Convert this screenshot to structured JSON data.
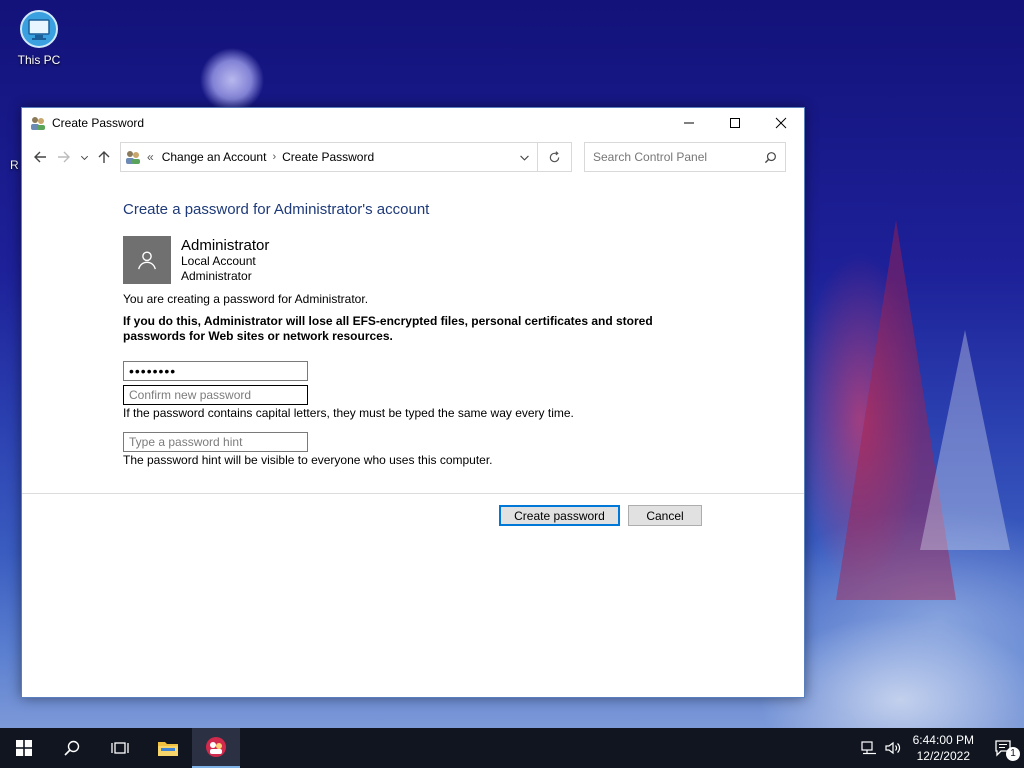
{
  "desktop": {
    "icon_label": "This PC",
    "edge_label": "R"
  },
  "window": {
    "title": "Create Password",
    "address": {
      "overflow": "«",
      "crumbs": [
        "Change an Account",
        "Create Password"
      ],
      "separator": "›"
    },
    "search_placeholder": "Search Control Panel"
  },
  "content": {
    "heading": "Create a password for Administrator's account",
    "account": {
      "name": "Administrator",
      "type": "Local Account",
      "group": "Administrator"
    },
    "intro": "You are creating a password for Administrator.",
    "warning": "If you do this, Administrator will lose all EFS-encrypted files, personal certificates and stored passwords for Web sites or network resources.",
    "new_password_value": "12345678",
    "confirm_placeholder": "Confirm new password",
    "capital_note": "If the password contains capital letters, they must be typed the same way every time.",
    "hint_placeholder": "Type a password hint",
    "hint_note": "The password hint will be visible to everyone who uses this computer."
  },
  "buttons": {
    "create": "Create password",
    "cancel": "Cancel"
  },
  "taskbar": {
    "time": "6:44:00 PM",
    "date": "12/2/2022",
    "notification_count": "1"
  },
  "colors": {
    "heading": "#1e3a78",
    "primary_border": "#0078d7",
    "taskbar": "#101520"
  }
}
